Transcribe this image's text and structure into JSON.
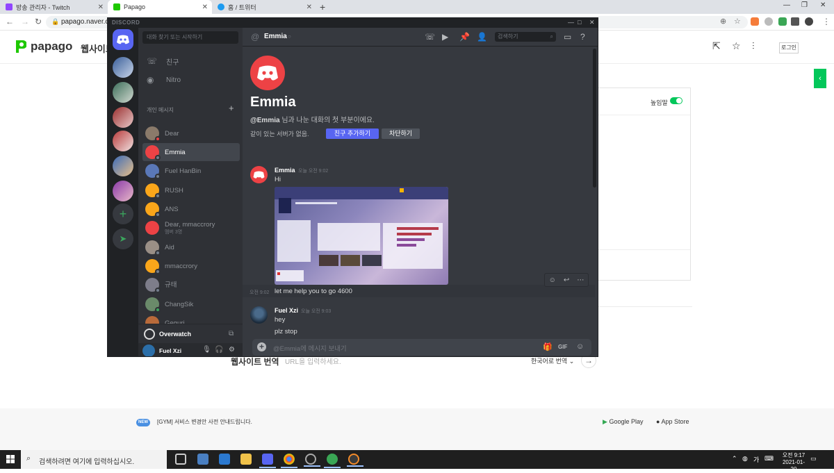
{
  "browser": {
    "tabs": [
      {
        "label": "방송 관리자 - Twitch",
        "color": "#9146ff"
      },
      {
        "label": "Papago",
        "color": "#1ec800"
      },
      {
        "label": "홈 / 트위터",
        "color": "#1d9bf0"
      }
    ],
    "url": "papago.naver.com"
  },
  "papago": {
    "logo": "papago",
    "nav": "웹사이트",
    "login": "로그인",
    "honorific": "높임말",
    "website_translate": "웹사이트 번역",
    "url_placeholder": "URL을 입력하세요.",
    "target_lang": "한국어로 번역",
    "notice_badge": "NEW",
    "notice": "[GYM] 서비스 변경안 사전 안내드립니다.",
    "google_play": "Google Play",
    "app_store": "App Store"
  },
  "discord": {
    "brand": "DISCORD",
    "dm_search_placeholder": "대화 찾기 또는 시작하기",
    "friends_label": "친구",
    "nitro_label": "Nitro",
    "dm_header": "개인 메시지",
    "dms": [
      {
        "name": "Dear",
        "sub": "",
        "color": "#8a7a6a",
        "status": "dnd"
      },
      {
        "name": "Emmia",
        "sub": "",
        "color": "#ed4245",
        "status": "offline"
      },
      {
        "name": "Fuel HanBin",
        "sub": "",
        "color": "#5a78b8",
        "status": "offline"
      },
      {
        "name": "RUSH",
        "sub": "",
        "color": "#faa61a",
        "status": "offline"
      },
      {
        "name": "ANS",
        "sub": "",
        "color": "#faa61a",
        "status": "offline"
      },
      {
        "name": "Dear, mmaccrory",
        "sub": "멤버 3명",
        "color": "#ed4245",
        "status": "none"
      },
      {
        "name": "Aid",
        "sub": "",
        "color": "#9a8f86",
        "status": "offline"
      },
      {
        "name": "mmaccrory",
        "sub": "",
        "color": "#faa61a",
        "status": "offline"
      },
      {
        "name": "규태",
        "sub": "",
        "color": "#7d7d8a",
        "status": "offline"
      },
      {
        "name": "ChangSik",
        "sub": "",
        "color": "#6a8a6a",
        "status": "online"
      },
      {
        "name": "Geguri",
        "sub": "",
        "color": "#b86a3a",
        "status": "offline"
      }
    ],
    "activity": "Overwatch",
    "current_user": "Fuel Xzi",
    "channel": {
      "name": "Emmia",
      "search_placeholder": "검색하기"
    },
    "welcome": {
      "name": "Emmia",
      "desc_handle": "@Emmia",
      "desc_rest": " 님과 나눈 대화의 첫 부분이에요.",
      "no_servers": "같이 있는 서버가 없음.",
      "add_friend": "친구 추가하기",
      "block": "차단하기"
    },
    "messages": [
      {
        "author": "Emmia",
        "time": "오늘 오전 9:02",
        "lines": [
          "Hi"
        ]
      },
      {
        "author": "",
        "time": "오전 9:02",
        "lines": [
          "let me help you to go 4600"
        ]
      },
      {
        "author": "Fuel Xzi",
        "time": "오늘 오전 9:03",
        "lines": [
          "hey",
          "plz stop"
        ]
      }
    ],
    "composer_placeholder": "@Emmia에 메시지 보내기"
  },
  "taskbar": {
    "search_placeholder": "검색하려면 여기에 입력하십시오.",
    "ime": "가",
    "time": "오전 9:17",
    "date": "2021-01-20"
  }
}
